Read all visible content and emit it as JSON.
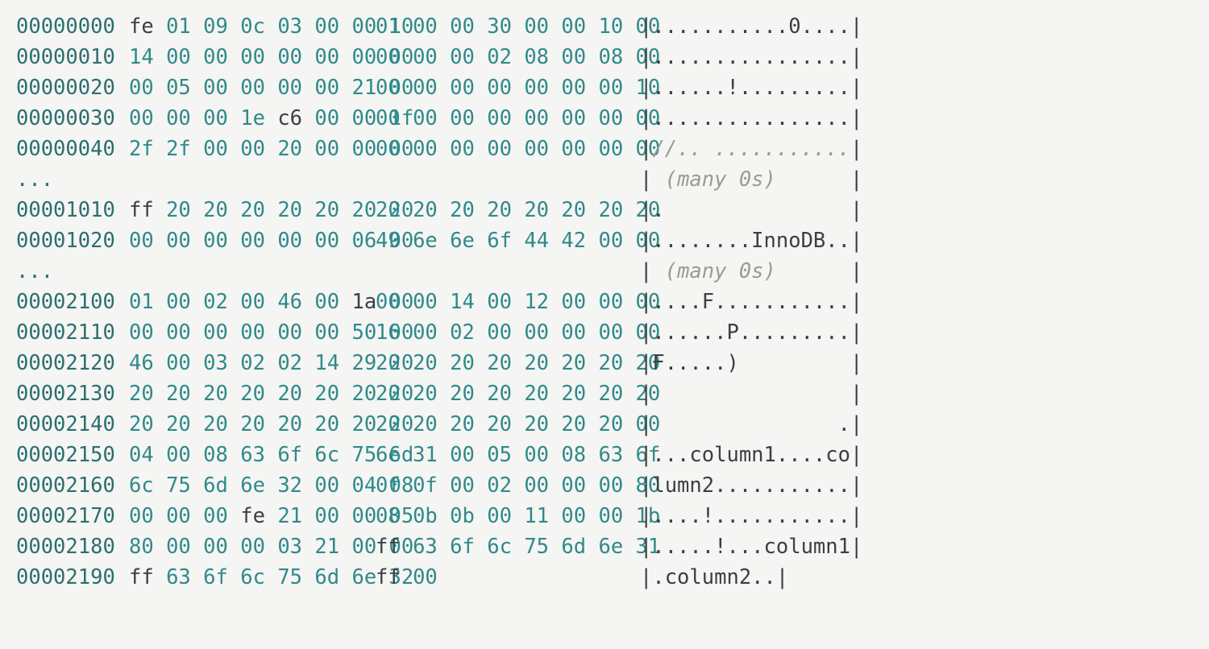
{
  "rows": [
    {
      "offset": "00000000",
      "hex": [
        "fe",
        "01",
        "09",
        "0c",
        "03",
        "00",
        "00",
        "10",
        "01",
        "00",
        "00",
        "30",
        "00",
        "00",
        "10",
        "00"
      ],
      "dark": [
        1,
        0,
        0,
        0,
        0,
        0,
        0,
        0,
        0,
        0,
        0,
        0,
        0,
        0,
        0,
        0
      ],
      "ascii": "|...........0....|",
      "comment": 0
    },
    {
      "offset": "00000010",
      "hex": [
        "14",
        "00",
        "00",
        "00",
        "00",
        "00",
        "00",
        "00",
        "00",
        "00",
        "00",
        "02",
        "08",
        "00",
        "08",
        "00"
      ],
      "dark": [
        0,
        0,
        0,
        0,
        0,
        0,
        0,
        0,
        0,
        0,
        0,
        0,
        0,
        0,
        0,
        0
      ],
      "ascii": "|................|",
      "comment": 0
    },
    {
      "offset": "00000020",
      "hex": [
        "00",
        "05",
        "00",
        "00",
        "00",
        "00",
        "21",
        "00",
        "00",
        "00",
        "00",
        "00",
        "00",
        "00",
        "00",
        "10"
      ],
      "dark": [
        0,
        0,
        0,
        0,
        0,
        0,
        0,
        0,
        0,
        0,
        0,
        0,
        0,
        0,
        0,
        0
      ],
      "ascii": "|......!.........|",
      "comment": 0
    },
    {
      "offset": "00000030",
      "hex": [
        "00",
        "00",
        "00",
        "1e",
        "c6",
        "00",
        "00",
        "1f",
        "00",
        "00",
        "00",
        "00",
        "00",
        "00",
        "00",
        "00"
      ],
      "dark": [
        0,
        0,
        0,
        0,
        1,
        0,
        0,
        0,
        0,
        0,
        0,
        0,
        0,
        0,
        0,
        0
      ],
      "ascii": "|................|",
      "comment": 0
    },
    {
      "offset": "00000040",
      "hex": [
        "2f",
        "2f",
        "00",
        "00",
        "20",
        "00",
        "00",
        "00",
        "00",
        "00",
        "00",
        "00",
        "00",
        "00",
        "00",
        "00"
      ],
      "dark": [
        0,
        0,
        0,
        0,
        0,
        0,
        0,
        0,
        0,
        0,
        0,
        0,
        0,
        0,
        0,
        0
      ],
      "ascii": "|//.. ...........|",
      "comment": 1
    },
    {
      "offset": "...",
      "hex": [],
      "dark": [],
      "ascii": "| (many 0s)      |",
      "comment": 1
    },
    {
      "offset": "00001010",
      "hex": [
        "ff",
        "20",
        "20",
        "20",
        "20",
        "20",
        "20",
        "20",
        "20",
        "20",
        "20",
        "20",
        "20",
        "20",
        "20",
        "20"
      ],
      "dark": [
        1,
        0,
        0,
        0,
        0,
        0,
        0,
        0,
        0,
        0,
        0,
        0,
        0,
        0,
        0,
        0
      ],
      "ascii": "|.               |",
      "comment": 0
    },
    {
      "offset": "00001020",
      "hex": [
        "00",
        "00",
        "00",
        "00",
        "00",
        "00",
        "06",
        "00",
        "49",
        "6e",
        "6e",
        "6f",
        "44",
        "42",
        "00",
        "00"
      ],
      "dark": [
        0,
        0,
        0,
        0,
        0,
        0,
        0,
        0,
        0,
        0,
        0,
        0,
        0,
        0,
        0,
        0
      ],
      "ascii": "|........InnoDB..|",
      "comment": 0
    },
    {
      "offset": "...",
      "hex": [],
      "dark": [],
      "ascii": "| (many 0s)      |",
      "comment": 1
    },
    {
      "offset": "00002100",
      "hex": [
        "01",
        "00",
        "02",
        "00",
        "46",
        "00",
        "1a",
        "00",
        "00",
        "00",
        "14",
        "00",
        "12",
        "00",
        "00",
        "00"
      ],
      "dark": [
        0,
        0,
        0,
        0,
        0,
        0,
        1,
        0,
        0,
        0,
        0,
        0,
        0,
        0,
        0,
        0
      ],
      "ascii": "|....F...........|",
      "comment": 0
    },
    {
      "offset": "00002110",
      "hex": [
        "00",
        "00",
        "00",
        "00",
        "00",
        "00",
        "50",
        "00",
        "16",
        "00",
        "02",
        "00",
        "00",
        "00",
        "00",
        "00"
      ],
      "dark": [
        0,
        0,
        0,
        0,
        0,
        0,
        0,
        0,
        0,
        0,
        0,
        0,
        0,
        0,
        0,
        0
      ],
      "ascii": "|......P.........|",
      "comment": 0
    },
    {
      "offset": "00002120",
      "hex": [
        "46",
        "00",
        "03",
        "02",
        "02",
        "14",
        "29",
        "20",
        "20",
        "20",
        "20",
        "20",
        "20",
        "20",
        "20",
        "20"
      ],
      "dark": [
        0,
        0,
        0,
        0,
        0,
        0,
        0,
        0,
        0,
        0,
        0,
        0,
        0,
        0,
        0,
        0
      ],
      "ascii": "|F.....)         |",
      "comment": 0
    },
    {
      "offset": "00002130",
      "hex": [
        "20",
        "20",
        "20",
        "20",
        "20",
        "20",
        "20",
        "20",
        "20",
        "20",
        "20",
        "20",
        "20",
        "20",
        "20",
        "20"
      ],
      "dark": [
        0,
        0,
        0,
        0,
        0,
        0,
        0,
        0,
        0,
        0,
        0,
        0,
        0,
        0,
        0,
        0
      ],
      "ascii": "|                |",
      "comment": 0
    },
    {
      "offset": "00002140",
      "hex": [
        "20",
        "20",
        "20",
        "20",
        "20",
        "20",
        "20",
        "20",
        "20",
        "20",
        "20",
        "20",
        "20",
        "20",
        "20",
        "00"
      ],
      "dark": [
        0,
        0,
        0,
        0,
        0,
        0,
        0,
        0,
        0,
        0,
        0,
        0,
        0,
        0,
        0,
        0
      ],
      "ascii": "|               .|",
      "comment": 0
    },
    {
      "offset": "00002150",
      "hex": [
        "04",
        "00",
        "08",
        "63",
        "6f",
        "6c",
        "75",
        "6d",
        "6e",
        "31",
        "00",
        "05",
        "00",
        "08",
        "63",
        "6f"
      ],
      "dark": [
        0,
        0,
        0,
        0,
        0,
        0,
        0,
        0,
        0,
        0,
        0,
        0,
        0,
        0,
        0,
        0
      ],
      "ascii": "|...column1....co|",
      "comment": 0
    },
    {
      "offset": "00002160",
      "hex": [
        "6c",
        "75",
        "6d",
        "6e",
        "32",
        "00",
        "04",
        "08",
        "0f",
        "0f",
        "00",
        "02",
        "00",
        "00",
        "00",
        "80"
      ],
      "dark": [
        0,
        0,
        0,
        0,
        0,
        0,
        0,
        0,
        0,
        0,
        0,
        0,
        0,
        0,
        0,
        0
      ],
      "ascii": "|lumn2...........|",
      "comment": 0
    },
    {
      "offset": "00002170",
      "hex": [
        "00",
        "00",
        "00",
        "fe",
        "21",
        "00",
        "00",
        "05",
        "08",
        "0b",
        "0b",
        "00",
        "11",
        "00",
        "00",
        "1b"
      ],
      "dark": [
        0,
        0,
        0,
        1,
        0,
        0,
        0,
        0,
        0,
        0,
        0,
        0,
        0,
        0,
        0,
        0
      ],
      "ascii": "|....!...........|",
      "comment": 0
    },
    {
      "offset": "00002180",
      "hex": [
        "80",
        "00",
        "00",
        "00",
        "03",
        "21",
        "00",
        "00",
        "ff",
        "63",
        "6f",
        "6c",
        "75",
        "6d",
        "6e",
        "31"
      ],
      "dark": [
        0,
        0,
        0,
        0,
        0,
        0,
        0,
        0,
        1,
        0,
        0,
        0,
        0,
        0,
        0,
        0
      ],
      "ascii": "|.....!...column1|",
      "comment": 0
    },
    {
      "offset": "00002190",
      "hex": [
        "ff",
        "63",
        "6f",
        "6c",
        "75",
        "6d",
        "6e",
        "32",
        "ff",
        "00"
      ],
      "dark": [
        1,
        0,
        0,
        0,
        0,
        0,
        0,
        0,
        1,
        0
      ],
      "ascii": "|.column2..|",
      "comment": 0
    }
  ]
}
